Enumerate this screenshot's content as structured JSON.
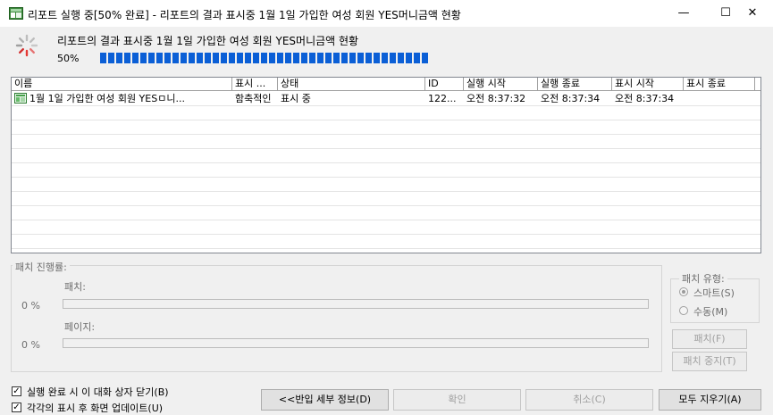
{
  "window": {
    "title": "리포트 실행 중[50% 완료] - 리포트의 결과 표시중 1월 1일 가입한 여성 회원 YES머니금액 현황",
    "minimize": "—",
    "maximize": "☐",
    "close": "✕"
  },
  "header": {
    "report_title": "리포트의 결과 표시중 1월 1일 가입한 여성 회원 YES머니금액 현황",
    "percent_label": "50%",
    "progress": 0.5
  },
  "list": {
    "columns": [
      "이름",
      "표시 ...",
      "상태",
      "ID",
      "실행 시작",
      "실행 종료",
      "표시 시작",
      "표시 종료"
    ],
    "rows": [
      {
        "name": "1월 1일 가입한 여성 회원 YESㅁ니...",
        "display": "함축적인",
        "status": "표시 중",
        "id": "122...",
        "run_start": "오전 8:37:32",
        "run_end": "오전 8:37:34",
        "display_start": "오전 8:37:34",
        "display_end": ""
      }
    ]
  },
  "batch": {
    "group_label": "패치 진행률:",
    "batch_label": "패치:",
    "batch_percent": "0 %",
    "batch_progress": 0,
    "page_label": "페이지:",
    "page_percent": "0 %",
    "page_progress": 0
  },
  "batch_type": {
    "group_label": "패치 유형:",
    "smart": "스마트(S)",
    "manual": "수동(M)",
    "selected": "smart"
  },
  "side_buttons": {
    "batch": "패치(F)",
    "batch_stop": "패치 중지(T)"
  },
  "checkboxes": {
    "close_on_complete": "실행 완료 시 이 대화 상자 닫기(B)",
    "close_checked": true,
    "update_after_display": "각각의 표시 후 화면 업데이트(U)",
    "update_checked": true
  },
  "buttons": {
    "details": "<<반입 세부 정보(D)",
    "ok": "확인",
    "cancel": "취소(C)",
    "clear_all": "모두 지우기(A)"
  }
}
